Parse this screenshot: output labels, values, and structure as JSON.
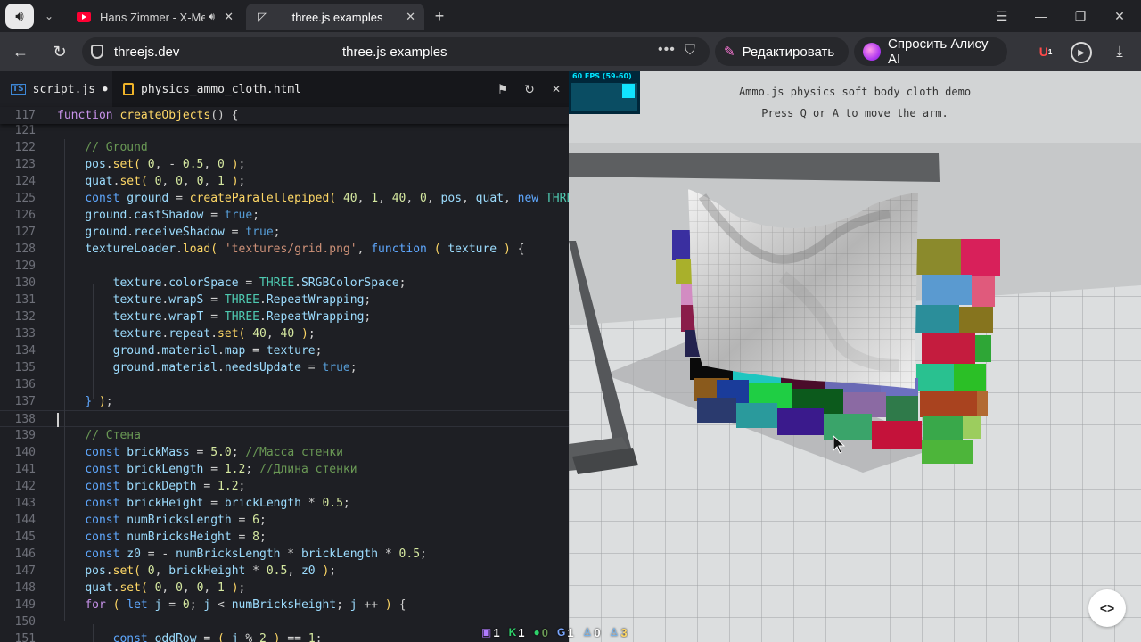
{
  "browser": {
    "tabs": [
      {
        "title": "Hans Zimmer - X-Me",
        "icon": "youtube-icon",
        "audio": true
      },
      {
        "title": "three.js examples",
        "icon": "threejs-icon",
        "active": true
      }
    ],
    "address": {
      "domain": "threejs.dev",
      "title": "three.js examples"
    },
    "actions": {
      "edit_label": "Редактировать",
      "alice_label": "Спросить Алису AI"
    },
    "ext_badge": "1"
  },
  "editor": {
    "tabs": [
      {
        "label": "script.js",
        "dirty": true,
        "icon": "ts-file-icon"
      },
      {
        "label": "physics_ammo_cloth.html",
        "icon": "html-file-icon"
      }
    ],
    "sticky": {
      "num": "117",
      "segs": [
        [
          "k",
          "function "
        ],
        [
          "f",
          "createObjects"
        ],
        [
          "o",
          "() {"
        ]
      ]
    },
    "lines": [
      {
        "num": "121",
        "segs": []
      },
      {
        "num": "122",
        "segs": [
          [
            "o",
            "    "
          ],
          [
            "c",
            "// Ground"
          ]
        ]
      },
      {
        "num": "123",
        "segs": [
          [
            "o",
            "    "
          ],
          [
            "v",
            "pos"
          ],
          [
            "o",
            "."
          ],
          [
            "f",
            "set"
          ],
          [
            "p",
            "( "
          ],
          [
            "n",
            "0"
          ],
          [
            "o",
            ", - "
          ],
          [
            "n",
            "0.5"
          ],
          [
            "o",
            ", "
          ],
          [
            "n",
            "0"
          ],
          [
            "p",
            " )"
          ],
          [
            "o",
            ";"
          ]
        ]
      },
      {
        "num": "124",
        "segs": [
          [
            "o",
            "    "
          ],
          [
            "v",
            "quat"
          ],
          [
            "o",
            "."
          ],
          [
            "f",
            "set"
          ],
          [
            "p",
            "( "
          ],
          [
            "n",
            "0"
          ],
          [
            "o",
            ", "
          ],
          [
            "n",
            "0"
          ],
          [
            "o",
            ", "
          ],
          [
            "n",
            "0"
          ],
          [
            "o",
            ", "
          ],
          [
            "n",
            "1"
          ],
          [
            "p",
            " )"
          ],
          [
            "o",
            ";"
          ]
        ]
      },
      {
        "num": "125",
        "segs": [
          [
            "o",
            "    "
          ],
          [
            "kb",
            "const "
          ],
          [
            "v",
            "ground"
          ],
          [
            "o",
            " = "
          ],
          [
            "f",
            "createParalellepiped"
          ],
          [
            "p",
            "( "
          ],
          [
            "n",
            "40"
          ],
          [
            "o",
            ", "
          ],
          [
            "n",
            "1"
          ],
          [
            "o",
            ", "
          ],
          [
            "n",
            "40"
          ],
          [
            "o",
            ", "
          ],
          [
            "n",
            "0"
          ],
          [
            "o",
            ", "
          ],
          [
            "v",
            "pos"
          ],
          [
            "o",
            ", "
          ],
          [
            "v",
            "quat"
          ],
          [
            "o",
            ", "
          ],
          [
            "kb",
            "new "
          ],
          [
            "t",
            "THREE"
          ]
        ]
      },
      {
        "num": "126",
        "segs": [
          [
            "o",
            "    "
          ],
          [
            "v",
            "ground"
          ],
          [
            "o",
            "."
          ],
          [
            "v",
            "castShadow"
          ],
          [
            "o",
            " = "
          ],
          [
            "tr",
            "true"
          ],
          [
            "o",
            ";"
          ]
        ]
      },
      {
        "num": "127",
        "segs": [
          [
            "o",
            "    "
          ],
          [
            "v",
            "ground"
          ],
          [
            "o",
            "."
          ],
          [
            "v",
            "receiveShadow"
          ],
          [
            "o",
            " = "
          ],
          [
            "tr",
            "true"
          ],
          [
            "o",
            ";"
          ]
        ]
      },
      {
        "num": "128",
        "segs": [
          [
            "o",
            "    "
          ],
          [
            "v",
            "textureLoader"
          ],
          [
            "o",
            "."
          ],
          [
            "f",
            "load"
          ],
          [
            "p",
            "( "
          ],
          [
            "s",
            "'textures/grid.png'"
          ],
          [
            "o",
            ", "
          ],
          [
            "kb",
            "function "
          ],
          [
            "p",
            "( "
          ],
          [
            "v",
            "texture"
          ],
          [
            "p",
            " ) "
          ],
          [
            "o",
            "{"
          ]
        ]
      },
      {
        "num": "129",
        "segs": []
      },
      {
        "num": "130",
        "segs": [
          [
            "o",
            "        "
          ],
          [
            "v",
            "texture"
          ],
          [
            "o",
            "."
          ],
          [
            "v",
            "colorSpace"
          ],
          [
            "o",
            " = "
          ],
          [
            "t",
            "THREE"
          ],
          [
            "o",
            "."
          ],
          [
            "v",
            "SRGBColorSpace"
          ],
          [
            "o",
            ";"
          ]
        ]
      },
      {
        "num": "131",
        "segs": [
          [
            "o",
            "        "
          ],
          [
            "v",
            "texture"
          ],
          [
            "o",
            "."
          ],
          [
            "v",
            "wrapS"
          ],
          [
            "o",
            " = "
          ],
          [
            "t",
            "THREE"
          ],
          [
            "o",
            "."
          ],
          [
            "v",
            "RepeatWrapping"
          ],
          [
            "o",
            ";"
          ]
        ]
      },
      {
        "num": "132",
        "segs": [
          [
            "o",
            "        "
          ],
          [
            "v",
            "texture"
          ],
          [
            "o",
            "."
          ],
          [
            "v",
            "wrapT"
          ],
          [
            "o",
            " = "
          ],
          [
            "t",
            "THREE"
          ],
          [
            "o",
            "."
          ],
          [
            "v",
            "RepeatWrapping"
          ],
          [
            "o",
            ";"
          ]
        ]
      },
      {
        "num": "133",
        "segs": [
          [
            "o",
            "        "
          ],
          [
            "v",
            "texture"
          ],
          [
            "o",
            "."
          ],
          [
            "v",
            "repeat"
          ],
          [
            "o",
            "."
          ],
          [
            "f",
            "set"
          ],
          [
            "p",
            "( "
          ],
          [
            "n",
            "40"
          ],
          [
            "o",
            ", "
          ],
          [
            "n",
            "40"
          ],
          [
            "p",
            " )"
          ],
          [
            "o",
            ";"
          ]
        ]
      },
      {
        "num": "134",
        "segs": [
          [
            "o",
            "        "
          ],
          [
            "v",
            "ground"
          ],
          [
            "o",
            "."
          ],
          [
            "v",
            "material"
          ],
          [
            "o",
            "."
          ],
          [
            "v",
            "map"
          ],
          [
            "o",
            " = "
          ],
          [
            "v",
            "texture"
          ],
          [
            "o",
            ";"
          ]
        ]
      },
      {
        "num": "135",
        "segs": [
          [
            "o",
            "        "
          ],
          [
            "v",
            "ground"
          ],
          [
            "o",
            "."
          ],
          [
            "v",
            "material"
          ],
          [
            "o",
            "."
          ],
          [
            "v",
            "needsUpdate"
          ],
          [
            "o",
            " = "
          ],
          [
            "tr",
            "true"
          ],
          [
            "o",
            ";"
          ]
        ]
      },
      {
        "num": "136",
        "segs": []
      },
      {
        "num": "137",
        "segs": [
          [
            "o",
            "    "
          ],
          [
            "kb",
            "}"
          ],
          [
            "p",
            " )"
          ],
          [
            "o",
            ";"
          ]
        ]
      },
      {
        "num": "138",
        "segs": [],
        "current": true
      },
      {
        "num": "139",
        "segs": [
          [
            "o",
            "    "
          ],
          [
            "c",
            "// Стена"
          ]
        ]
      },
      {
        "num": "140",
        "segs": [
          [
            "o",
            "    "
          ],
          [
            "kb",
            "const "
          ],
          [
            "v",
            "brickMass"
          ],
          [
            "o",
            " = "
          ],
          [
            "n",
            "5.0"
          ],
          [
            "o",
            "; "
          ],
          [
            "c",
            "//Масса стенки"
          ]
        ]
      },
      {
        "num": "141",
        "segs": [
          [
            "o",
            "    "
          ],
          [
            "kb",
            "const "
          ],
          [
            "v",
            "brickLength"
          ],
          [
            "o",
            " = "
          ],
          [
            "n",
            "1.2"
          ],
          [
            "o",
            "; "
          ],
          [
            "c",
            "//Длина стенки"
          ]
        ]
      },
      {
        "num": "142",
        "segs": [
          [
            "o",
            "    "
          ],
          [
            "kb",
            "const "
          ],
          [
            "v",
            "brickDepth"
          ],
          [
            "o",
            " = "
          ],
          [
            "n",
            "1.2"
          ],
          [
            "o",
            ";"
          ]
        ]
      },
      {
        "num": "143",
        "segs": [
          [
            "o",
            "    "
          ],
          [
            "kb",
            "const "
          ],
          [
            "v",
            "brickHeight"
          ],
          [
            "o",
            " = "
          ],
          [
            "v",
            "brickLength"
          ],
          [
            "o",
            " * "
          ],
          [
            "n",
            "0.5"
          ],
          [
            "o",
            ";"
          ]
        ]
      },
      {
        "num": "144",
        "segs": [
          [
            "o",
            "    "
          ],
          [
            "kb",
            "const "
          ],
          [
            "v",
            "numBricksLength"
          ],
          [
            "o",
            " = "
          ],
          [
            "n",
            "6"
          ],
          [
            "o",
            ";"
          ]
        ]
      },
      {
        "num": "145",
        "segs": [
          [
            "o",
            "    "
          ],
          [
            "kb",
            "const "
          ],
          [
            "v",
            "numBricksHeight"
          ],
          [
            "o",
            " = "
          ],
          [
            "n",
            "8"
          ],
          [
            "o",
            ";"
          ]
        ]
      },
      {
        "num": "146",
        "segs": [
          [
            "o",
            "    "
          ],
          [
            "kb",
            "const "
          ],
          [
            "v",
            "z0"
          ],
          [
            "o",
            " = - "
          ],
          [
            "v",
            "numBricksLength"
          ],
          [
            "o",
            " * "
          ],
          [
            "v",
            "brickLength"
          ],
          [
            "o",
            " * "
          ],
          [
            "n",
            "0.5"
          ],
          [
            "o",
            ";"
          ]
        ]
      },
      {
        "num": "147",
        "segs": [
          [
            "o",
            "    "
          ],
          [
            "v",
            "pos"
          ],
          [
            "o",
            "."
          ],
          [
            "f",
            "set"
          ],
          [
            "p",
            "( "
          ],
          [
            "n",
            "0"
          ],
          [
            "o",
            ", "
          ],
          [
            "v",
            "brickHeight"
          ],
          [
            "o",
            " * "
          ],
          [
            "n",
            "0.5"
          ],
          [
            "o",
            ", "
          ],
          [
            "v",
            "z0"
          ],
          [
            "p",
            " )"
          ],
          [
            "o",
            ";"
          ]
        ]
      },
      {
        "num": "148",
        "segs": [
          [
            "o",
            "    "
          ],
          [
            "v",
            "quat"
          ],
          [
            "o",
            "."
          ],
          [
            "f",
            "set"
          ],
          [
            "p",
            "( "
          ],
          [
            "n",
            "0"
          ],
          [
            "o",
            ", "
          ],
          [
            "n",
            "0"
          ],
          [
            "o",
            ", "
          ],
          [
            "n",
            "0"
          ],
          [
            "o",
            ", "
          ],
          [
            "n",
            "1"
          ],
          [
            "p",
            " )"
          ],
          [
            "o",
            ";"
          ]
        ]
      },
      {
        "num": "149",
        "segs": [
          [
            "o",
            "    "
          ],
          [
            "k",
            "for "
          ],
          [
            "p",
            "( "
          ],
          [
            "kb",
            "let "
          ],
          [
            "v",
            "j"
          ],
          [
            "o",
            " = "
          ],
          [
            "n",
            "0"
          ],
          [
            "o",
            "; "
          ],
          [
            "v",
            "j"
          ],
          [
            "o",
            " < "
          ],
          [
            "v",
            "numBricksHeight"
          ],
          [
            "o",
            "; "
          ],
          [
            "v",
            "j"
          ],
          [
            "o",
            " ++ "
          ],
          [
            "p",
            ") "
          ],
          [
            "o",
            "{"
          ]
        ]
      },
      {
        "num": "150",
        "segs": []
      },
      {
        "num": "151",
        "segs": [
          [
            "o",
            "        "
          ],
          [
            "kb",
            "const "
          ],
          [
            "v",
            "oddRow"
          ],
          [
            "o",
            " = "
          ],
          [
            "p",
            "( "
          ],
          [
            "v",
            "j"
          ],
          [
            "o",
            " % "
          ],
          [
            "n",
            "2"
          ],
          [
            "p",
            " ) "
          ],
          [
            "o",
            "== "
          ],
          [
            "n",
            "1"
          ],
          [
            "o",
            ";"
          ]
        ]
      }
    ]
  },
  "viewer": {
    "fps_label": "60 FPS (59-60)",
    "info_line1": "Ammo.js physics soft body cloth demo",
    "info_line2": "Press Q or A to move the arm."
  },
  "overlay": [
    {
      "icon": "poll-icon",
      "value": "1"
    },
    {
      "icon": "kick-icon",
      "value": "1"
    },
    {
      "icon": "points-icon",
      "value": "0"
    },
    {
      "icon": "g-icon",
      "value": "1"
    },
    {
      "icon": "viewer-icon",
      "value": "0"
    },
    {
      "icon": "follower-icon",
      "value": "3"
    }
  ]
}
